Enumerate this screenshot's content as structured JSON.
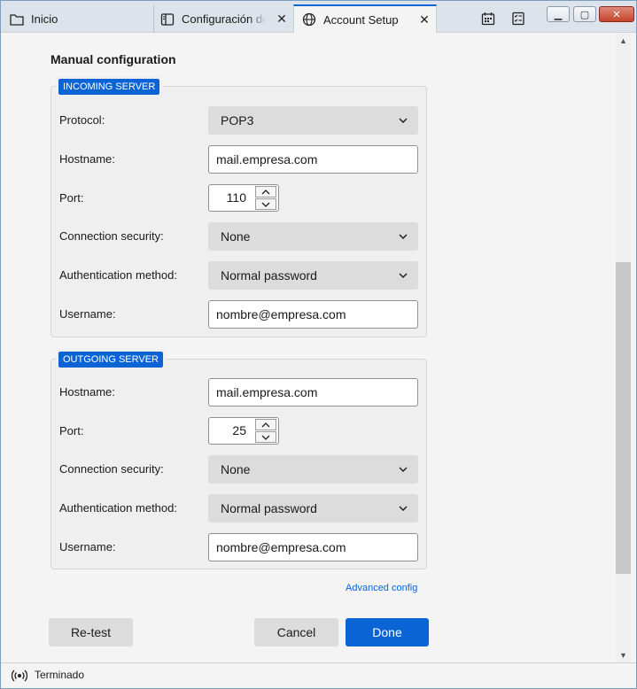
{
  "tabs": [
    {
      "label": "Inicio",
      "icon": "folder-icon"
    },
    {
      "label": "Configuración de la cuenta",
      "icon": "settings-page-icon"
    },
    {
      "label": "Account Setup",
      "icon": "globe-icon",
      "active": true
    }
  ],
  "toolbar": {
    "calendar_icon": "calendar-icon",
    "tasks_icon": "tasks-icon"
  },
  "window_controls": {
    "minimize": "minimize-icon",
    "maximize": "maximize-icon",
    "close": "close-icon"
  },
  "heading": "Manual configuration",
  "incoming": {
    "legend": "INCOMING SERVER",
    "protocol_label": "Protocol:",
    "protocol_value": "POP3",
    "hostname_label": "Hostname:",
    "hostname_value": "mail.empresa.com",
    "port_label": "Port:",
    "port_value": "110",
    "security_label": "Connection security:",
    "security_value": "None",
    "auth_label": "Authentication method:",
    "auth_value": "Normal password",
    "username_label": "Username:",
    "username_value": "nombre@empresa.com"
  },
  "outgoing": {
    "legend": "OUTGOING SERVER",
    "hostname_label": "Hostname:",
    "hostname_value": "mail.empresa.com",
    "port_label": "Port:",
    "port_value": "25",
    "security_label": "Connection security:",
    "security_value": "None",
    "auth_label": "Authentication method:",
    "auth_value": "Normal password",
    "username_label": "Username:",
    "username_value": "nombre@empresa.com"
  },
  "advanced_link": "Advanced config",
  "buttons": {
    "retest": "Re-test",
    "cancel": "Cancel",
    "done": "Done"
  },
  "status": {
    "text": "Terminado",
    "icon": "connection-status-icon"
  },
  "colors": {
    "accent": "#0a64d6",
    "select_bg": "#dcdcdc"
  }
}
